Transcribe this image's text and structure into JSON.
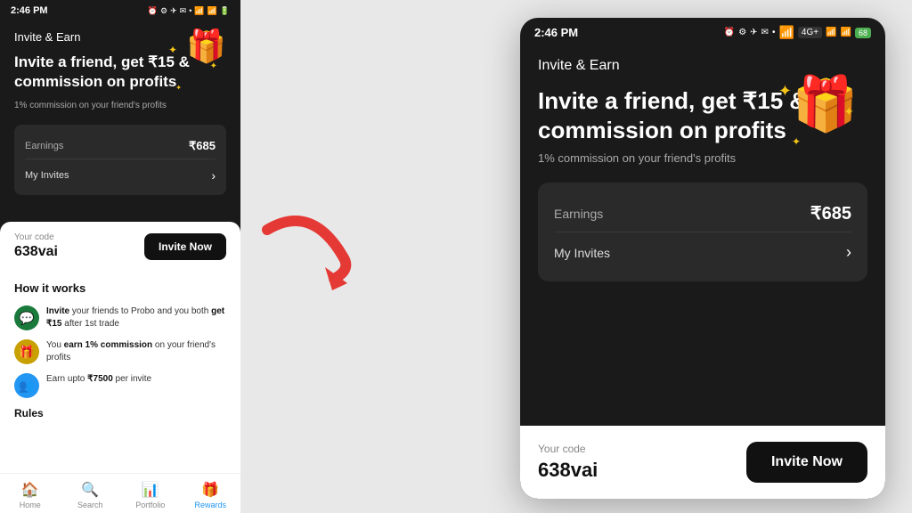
{
  "app": {
    "title": "Invite & Earn"
  },
  "left_phone": {
    "status_time": "2:46 PM",
    "title": "Invite & Earn",
    "headline_line1": "Invite a friend, get ₹15 &",
    "headline_line2": "commission on profits",
    "subtext": "1% commission on your friend's profits",
    "earnings_label": "Earnings",
    "earnings_value": "₹685",
    "invites_label": "My Invites",
    "your_code_label": "Your code",
    "your_code_value": "638vai",
    "invite_btn": "Invite Now",
    "how_title": "How it works",
    "how_items": [
      {
        "text": "Invite your friends to Probo and you both get ₹15 after 1st trade",
        "icon": "💬"
      },
      {
        "text": "You earn 1% commission on your friend's profits",
        "icon": "🎁"
      },
      {
        "text": "Earn upto ₹7500 per invite",
        "icon": "👥"
      }
    ],
    "rules_label": "Rules",
    "nav_items": [
      {
        "label": "Home",
        "icon": "🏠",
        "active": false
      },
      {
        "label": "Search",
        "icon": "🔍",
        "active": false
      },
      {
        "label": "Portfolio",
        "icon": "📊",
        "active": false
      },
      {
        "label": "Rewards",
        "icon": "🎁",
        "active": true
      }
    ]
  },
  "right_phone": {
    "status_time": "2:46 PM",
    "title": "Invite & Earn",
    "headline_line1": "Invite a friend, get ₹15 &",
    "headline_line2": "commission on profits",
    "subtext": "1% commission on your friend's profits",
    "earnings_label": "Earnings",
    "earnings_value": "₹685",
    "invites_label": "My Invites",
    "your_code_label": "Your code",
    "your_code_value": "638vai",
    "invite_btn": "Invite Now"
  },
  "arrow": {
    "color": "#e53935"
  }
}
